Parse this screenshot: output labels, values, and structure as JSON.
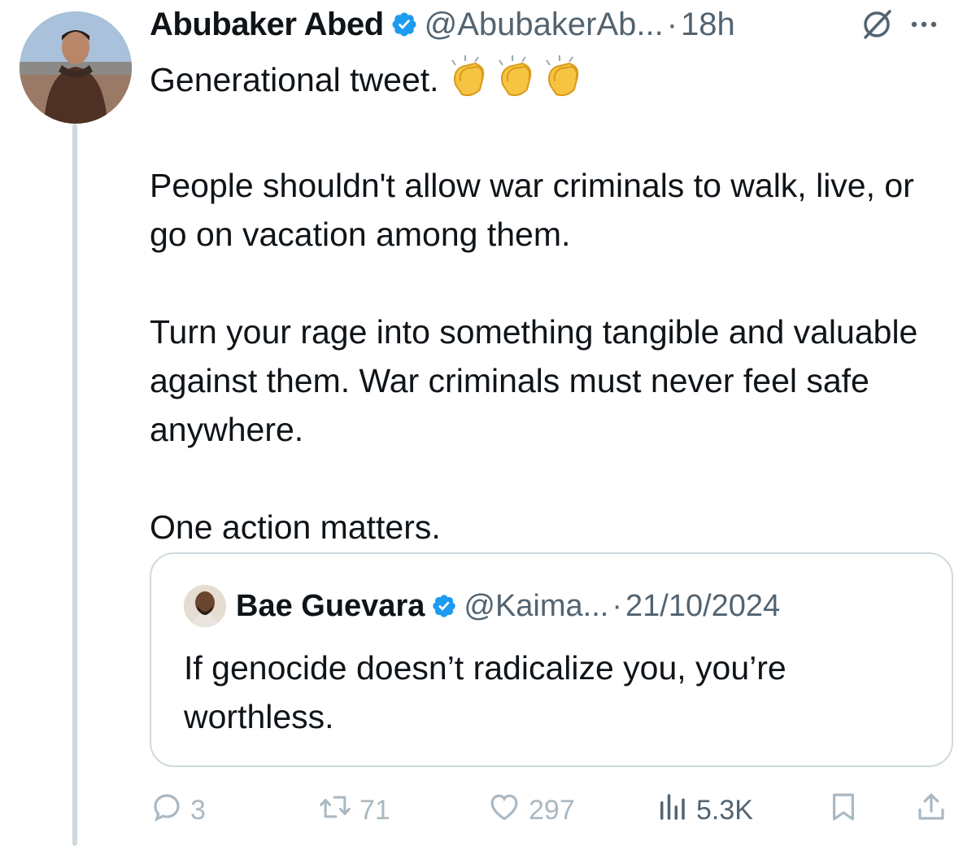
{
  "author": {
    "display_name": "Abubaker Abed",
    "handle": "@AbubakerAb...",
    "separator": "·",
    "time": "18h"
  },
  "tweet": {
    "line1": "Generational tweet.",
    "para2": "People shouldn't allow war criminals to walk, live, or go on vacation among them.",
    "para3": "Turn your rage into something tangible and valuable against them. War criminals must never feel safe anywhere.",
    "para4": "One action matters."
  },
  "quote": {
    "display_name": "Bae Guevara",
    "handle": "@Kaima...",
    "separator": "·",
    "date": "21/10/2024",
    "text": "If genocide doesn’t radicalize you, you’re worthless."
  },
  "actions": {
    "replies": "3",
    "reposts": "71",
    "likes": "297",
    "views": "5.3K"
  },
  "icons": [
    "verified-badge-icon",
    "grok-icon",
    "more-icon",
    "clap-emoji-icon",
    "reply-icon",
    "repost-icon",
    "like-icon",
    "views-icon",
    "bookmark-icon",
    "share-icon"
  ],
  "colors": {
    "text": "#0f1419",
    "secondary": "#536471",
    "verified": "#1d9bf0",
    "faded_action": "#aab8c2",
    "border": "#cfd9de"
  }
}
